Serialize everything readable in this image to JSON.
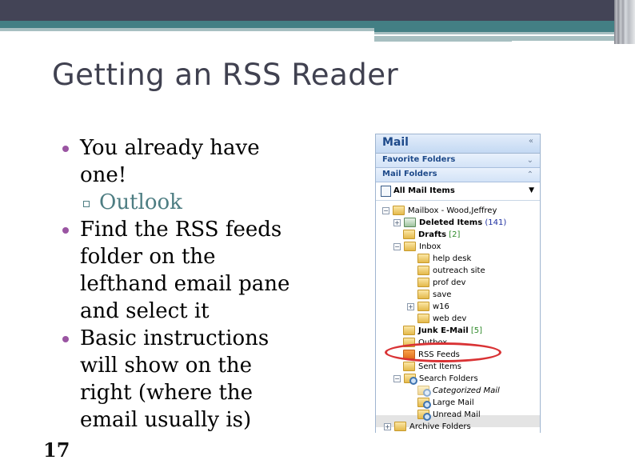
{
  "slide": {
    "title": "Getting an RSS Reader",
    "bullets": [
      {
        "level": 1,
        "text": "You already have one!"
      },
      {
        "level": 2,
        "text": "Outlook"
      },
      {
        "level": 1,
        "text": "Find the RSS feeds folder on the lefthand email pane and select it"
      },
      {
        "level": 1,
        "text": "Basic instructions will show on the right (where the email usually is)"
      }
    ],
    "slide_number": "17",
    "colors": {
      "title": "#404150",
      "bullet": "#9a55a2",
      "sub_bullet_text": "#4d7d82",
      "header_bar": "#434456",
      "accent_teal": "#437f84",
      "highlight_oval": "#d93234"
    }
  },
  "outlook_pane": {
    "header": "Mail",
    "collapse_icon": "double-chevron-left-icon",
    "sections": [
      {
        "label": "Favorite Folders",
        "icon": "double-chevron-down-icon"
      },
      {
        "label": "Mail Folders",
        "icon": "double-chevron-up-icon"
      }
    ],
    "all_mail_items": "All Mail Items",
    "tree": {
      "mailbox": "Mailbox - Wood,Jeffrey",
      "deleted_items": {
        "label": "Deleted Items",
        "count": "(141)"
      },
      "drafts": {
        "label": "Drafts",
        "count": "[2]"
      },
      "inbox": "Inbox",
      "inbox_children": [
        "help desk",
        "outreach site",
        "prof dev",
        "save",
        "w16",
        "web dev"
      ],
      "junk": {
        "label": "Junk E-Mail",
        "count": "[5]"
      },
      "outbox": "Outbox",
      "rss_feeds": "RSS Feeds",
      "sent_items": "Sent Items",
      "search_folders": "Search Folders",
      "search_children": [
        "Categorized Mail",
        "Large Mail",
        "Unread Mail"
      ],
      "archive": "Archive Folders"
    }
  }
}
